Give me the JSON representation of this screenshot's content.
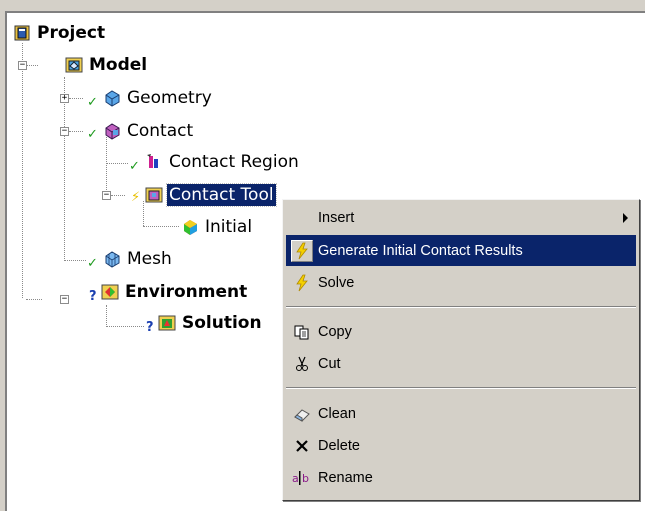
{
  "tree": {
    "project": {
      "label": "Project",
      "icon": "project-icon"
    },
    "model": {
      "label": "Model",
      "icon": "model-icon"
    },
    "geometry": {
      "label": "Geometry",
      "icon": "geometry-icon",
      "status": "✓"
    },
    "contact": {
      "label": "Contact",
      "icon": "contact-icon",
      "status": "✓"
    },
    "contact_region": {
      "label": "Contact Region",
      "icon": "contact-region-icon",
      "status": "✓"
    },
    "contact_tool": {
      "label": "Contact Tool",
      "icon": "contact-tool-icon",
      "status": "⚡"
    },
    "initial": {
      "label": "Initial",
      "icon": "initial-contact-icon"
    },
    "mesh": {
      "label": "Mesh",
      "icon": "mesh-icon",
      "status": "✓"
    },
    "environment": {
      "label": "Environment",
      "icon": "environment-icon",
      "status": "?"
    },
    "solution": {
      "label": "Solution",
      "icon": "solution-icon",
      "status": "?"
    },
    "expander_plus": "+",
    "expander_minus": "−"
  },
  "context_menu": {
    "items": [
      {
        "label": "Insert",
        "icon": "",
        "submenu": true
      },
      {
        "label": "Generate Initial Contact Results",
        "icon": "lightning-icon",
        "highlighted": true
      },
      {
        "label": "Solve",
        "icon": "lightning-icon"
      },
      {
        "label": "Copy",
        "icon": "copy-icon"
      },
      {
        "label": "Cut",
        "icon": "scissors-icon"
      },
      {
        "label": "Clean",
        "icon": "eraser-icon"
      },
      {
        "label": "Delete",
        "icon": "delete-x-icon"
      },
      {
        "label": "Rename",
        "icon": "rename-icon"
      }
    ]
  },
  "colors": {
    "selection": "#0a246a",
    "menu_bg": "#d4d0c8",
    "check": "#1e9a1e",
    "question": "#1a3fb0",
    "bolt": "#e8c000"
  }
}
